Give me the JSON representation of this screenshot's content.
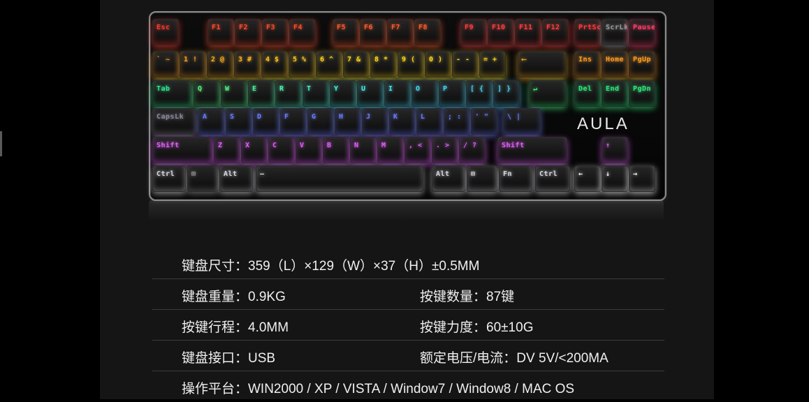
{
  "brand": "AULA",
  "keys": [
    {
      "label": "Esc",
      "color": "#ff3b30"
    },
    {
      "label": "F1",
      "color": "#ff4b2b"
    },
    {
      "label": "F2",
      "color": "#ff4b2b"
    },
    {
      "label": "F3",
      "color": "#ff4b2b"
    },
    {
      "label": "F4",
      "color": "#ff4b2b"
    },
    {
      "label": "F5",
      "color": "#ff5a2a"
    },
    {
      "label": "F6",
      "color": "#ff5a2a"
    },
    {
      "label": "F7",
      "color": "#ff5a2a"
    },
    {
      "label": "F8",
      "color": "#ff5a2a"
    },
    {
      "label": "F9",
      "color": "#ff3d3d"
    },
    {
      "label": "F10",
      "color": "#ff3d3d"
    },
    {
      "label": "F11",
      "color": "#ff3d3d"
    },
    {
      "label": "F12",
      "color": "#ff3d3d"
    },
    {
      "label": "PrtSc",
      "color": "#ff3b3b"
    },
    {
      "label": "ScrLk",
      "color": "#9a9a9a"
    },
    {
      "label": "Pause",
      "color": "#ff3b6b"
    },
    {
      "label": "` ~",
      "color": "#ff9a1f"
    },
    {
      "label": "1 !",
      "color": "#ffa11f"
    },
    {
      "label": "2 @",
      "color": "#ffae1f"
    },
    {
      "label": "3 #",
      "color": "#ffb41f"
    },
    {
      "label": "4 $",
      "color": "#ffc01f"
    },
    {
      "label": "5 %",
      "color": "#ffc81f"
    },
    {
      "label": "6 ^",
      "color": "#ffd21f"
    },
    {
      "label": "7 &",
      "color": "#ffd41f"
    },
    {
      "label": "8 *",
      "color": "#ffd81f"
    },
    {
      "label": "9 (",
      "color": "#ffd81f"
    },
    {
      "label": "0 )",
      "color": "#ffd81f"
    },
    {
      "label": "- -",
      "color": "#ffd81f"
    },
    {
      "label": "= +",
      "color": "#ffd81f"
    },
    {
      "label": "⟵",
      "color": "#ffb01f"
    },
    {
      "label": "Ins",
      "color": "#ff9a1f"
    },
    {
      "label": "Home",
      "color": "#ff9a1f"
    },
    {
      "label": "PgUp",
      "color": "#ff9a1f"
    },
    {
      "label": "Tab",
      "color": "#2ee68a"
    },
    {
      "label": "Q",
      "color": "#55f080"
    },
    {
      "label": "W",
      "color": "#55f080"
    },
    {
      "label": "E",
      "color": "#4ef09a"
    },
    {
      "label": "R",
      "color": "#4ef0b0"
    },
    {
      "label": "T",
      "color": "#4af0c8"
    },
    {
      "label": "Y",
      "color": "#4af0d8"
    },
    {
      "label": "U",
      "color": "#4ae8e8"
    },
    {
      "label": "I",
      "color": "#4ae0f0"
    },
    {
      "label": "O",
      "color": "#4ad8f0"
    },
    {
      "label": "P",
      "color": "#4ad0f0"
    },
    {
      "label": "[ {",
      "color": "#4ad0f0"
    },
    {
      "label": "] }",
      "color": "#4ad0f0"
    },
    {
      "label": "↵",
      "color": "#3ef07a"
    },
    {
      "label": "Del",
      "color": "#2ee67a"
    },
    {
      "label": "End",
      "color": "#2ee67a"
    },
    {
      "label": "PgDn",
      "color": "#2ee67a"
    },
    {
      "label": "CapsLk",
      "color": "#8a8a9a"
    },
    {
      "label": "A",
      "color": "#6a7dff"
    },
    {
      "label": "S",
      "color": "#6a7dff"
    },
    {
      "label": "D",
      "color": "#6a7dff"
    },
    {
      "label": "F",
      "color": "#6a7dff"
    },
    {
      "label": "G",
      "color": "#6a7dff"
    },
    {
      "label": "H",
      "color": "#6a7dff"
    },
    {
      "label": "J",
      "color": "#6a7dff"
    },
    {
      "label": "K",
      "color": "#6a7dff"
    },
    {
      "label": "L",
      "color": "#6a7dff"
    },
    {
      "label": "; :",
      "color": "#6a7dff"
    },
    {
      "label": "' \"",
      "color": "#6a7dff"
    },
    {
      "label": "\\ |",
      "color": "#6a7dff"
    },
    {
      "label": "Shift",
      "color": "#e45cff"
    },
    {
      "label": "Z",
      "color": "#e45cff"
    },
    {
      "label": "X",
      "color": "#e45cff"
    },
    {
      "label": "C",
      "color": "#e45cff"
    },
    {
      "label": "V",
      "color": "#e45cff"
    },
    {
      "label": "B",
      "color": "#e45cff"
    },
    {
      "label": "N",
      "color": "#e45cff"
    },
    {
      "label": "M",
      "color": "#e45cff"
    },
    {
      "label": ", <",
      "color": "#e45cff"
    },
    {
      "label": ". >",
      "color": "#e45cff"
    },
    {
      "label": "/ ?",
      "color": "#e45cff"
    },
    {
      "label": "Shift",
      "color": "#e45cff"
    },
    {
      "label": "↑",
      "color": "#e45cff"
    },
    {
      "label": "Ctrl",
      "color": "#d8d8e0"
    },
    {
      "label": "⊞",
      "color": "#9a9a9a"
    },
    {
      "label": "Alt",
      "color": "#d8d8e0"
    },
    {
      "label": "—",
      "color": "#d8d8e0"
    },
    {
      "label": "Alt",
      "color": "#d8d8e0"
    },
    {
      "label": "⊞",
      "color": "#d8d8e0"
    },
    {
      "label": "Fn",
      "color": "#d8d8e0"
    },
    {
      "label": "Ctrl",
      "color": "#d8d8e0"
    },
    {
      "label": "←",
      "color": "#ffffff"
    },
    {
      "label": "↓",
      "color": "#ffffff"
    },
    {
      "label": "→",
      "color": "#ffffff"
    }
  ],
  "specs": {
    "size": "键盘尺寸：359（L）×129（W）×37（H）±0.5MM",
    "weight": "键盘重量：0.9KG",
    "key_count": "按键数量：87键",
    "travel": "按键行程：4.0MM",
    "force": "按键力度：60±10G",
    "interface": "键盘接口：USB",
    "power": "额定电压/电流：DV 5V/<200MA",
    "platform": "操作平台：WIN2000 / XP / VISTA / Window7 / Window8 / MAC OS"
  }
}
